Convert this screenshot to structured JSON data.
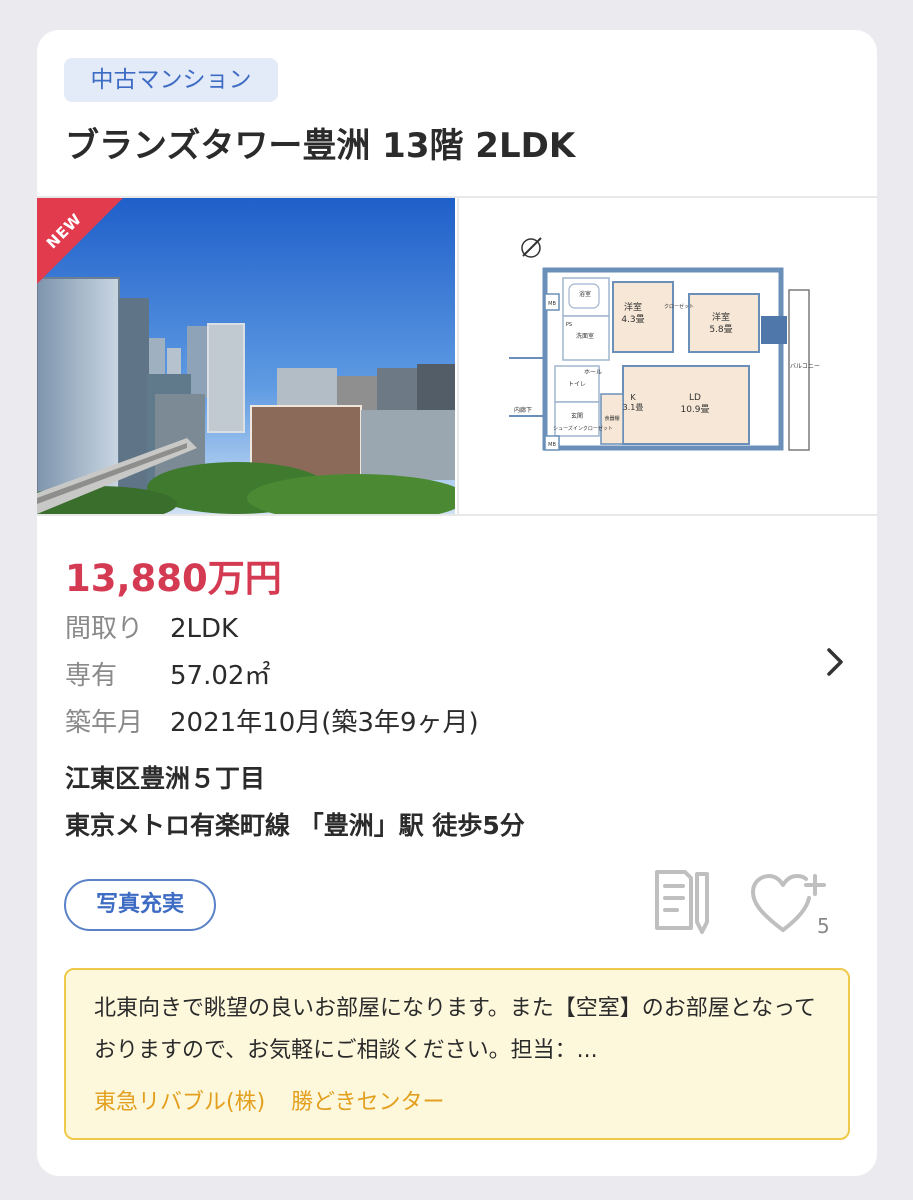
{
  "listing": {
    "category_tag": "中古マンション",
    "title": "ブランズタワー豊洲 13階 2LDK",
    "new_ribbon": "NEW",
    "price": "13,880万円",
    "specs": [
      {
        "label": "間取り",
        "value": "2LDK"
      },
      {
        "label": "専有",
        "value": "57.02㎡"
      },
      {
        "label": "築年月",
        "value": "2021年10月(築3年9ヶ月)"
      }
    ],
    "address": "江東区豊洲５丁目",
    "access": "東京メトロ有楽町線 「豊洲」駅 徒歩5分",
    "feature_badge": "写真充実",
    "favorite_count": "5",
    "icons": {
      "memo": "memo-icon",
      "favorite": "heart-plus-icon",
      "detail": "chevron-right-icon"
    },
    "colors": {
      "price": "#d43a52",
      "tag": "#3e6cc4",
      "note_border": "#efc94a",
      "agent": "#e3a020"
    }
  },
  "floorplan": {
    "rooms": {
      "bath": "浴室",
      "western_a": "洋室",
      "western_a_size": "4.3畳",
      "western_b": "洋室",
      "western_b_size": "5.8畳",
      "ld": "LD",
      "ld_size": "10.9畳",
      "kitchen": "K",
      "kitchen_size": "3.1畳",
      "toilet": "トイレ",
      "hall": "ホール",
      "entrance": "玄関",
      "washroom": "洗面室",
      "pantry": "食器棚",
      "closet": "クローゼット",
      "shoe_closet": "シューズインクローゼット",
      "balcony": "バルコニー",
      "corridor": "内廊下",
      "mb": "MB",
      "ps": "PS"
    }
  },
  "note": {
    "text": "北東向きで眺望の良いお部屋になります。また【空室】のお部屋となっておりますので、お気軽にご相談ください。担当：...",
    "agent_company": "東急リバブル(株)",
    "agent_branch": "勝どきセンター"
  }
}
